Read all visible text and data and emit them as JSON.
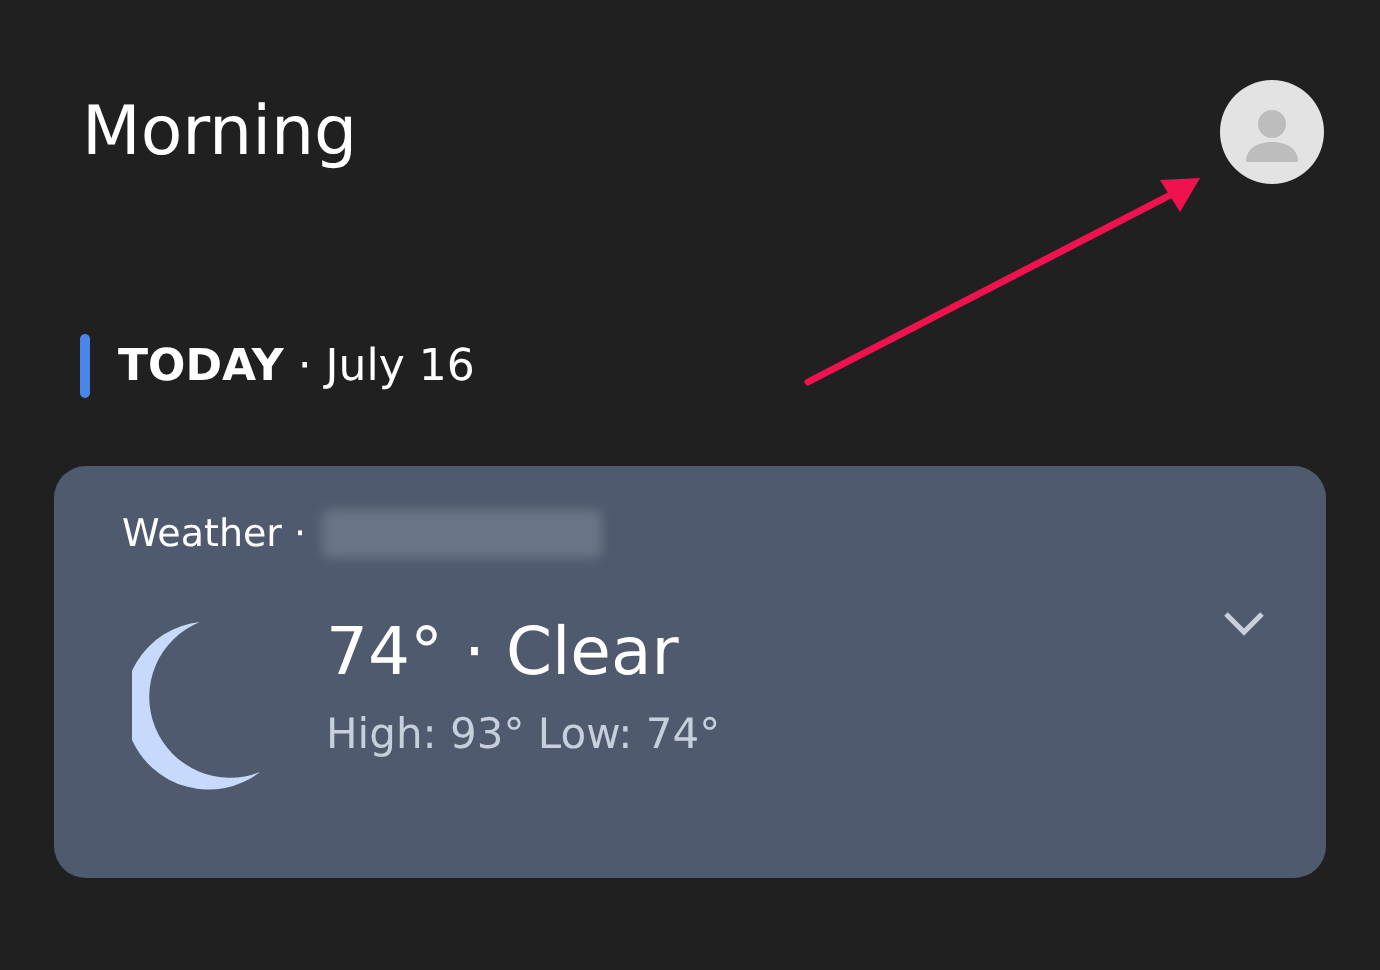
{
  "greeting": "Morning",
  "section": {
    "heading": "**TODAY** · July 16"
  },
  "weather": {
    "label": "Weather ·",
    "temperature": "74° · Clear",
    "range": "High: 93° Low: 74°",
    "expanded": false
  }
}
